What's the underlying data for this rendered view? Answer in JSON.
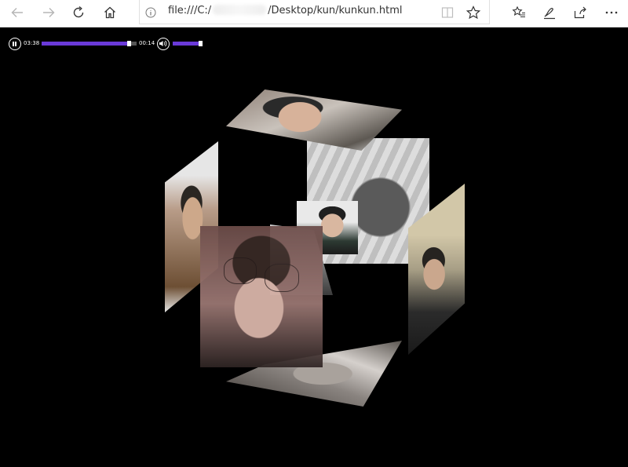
{
  "browser": {
    "url": "file:///C:/",
    "url_hidden": "",
    "url_rest": "/Desktop/kun/kunkun.html",
    "accent": "#0078d7"
  },
  "icons": {
    "back": "arrow-left-icon",
    "forward": "arrow-right-icon",
    "refresh": "refresh-icon",
    "home": "home-icon",
    "info": "info-icon",
    "reading_view": "reading-view-icon",
    "favorite": "star-icon",
    "favorites_hub": "favorites-list-icon",
    "notes": "pen-icon",
    "share": "share-icon",
    "more": "more-icon",
    "pause": "pause-icon",
    "volume": "volume-icon"
  },
  "player": {
    "current_time": "03:38",
    "duration": "00:14",
    "progress_fraction": 0.94,
    "volume_fraction": 1.0,
    "fill_color": "#6a3ad9"
  },
  "scene": {
    "background": "#000000",
    "cube_faces": [
      "top",
      "back-right",
      "left",
      "right",
      "inner-top",
      "inner-mid",
      "front",
      "bottom"
    ]
  }
}
